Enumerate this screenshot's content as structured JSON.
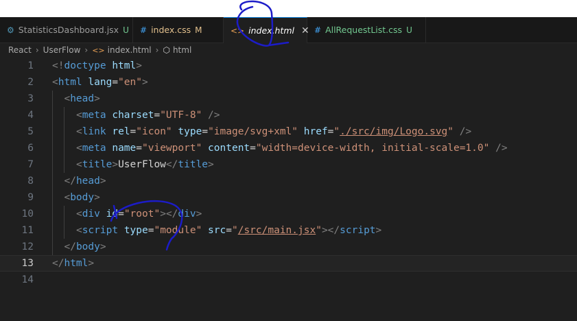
{
  "tabs": [
    {
      "icon": "⚙",
      "label": "StatisticsDashboard.jsx",
      "badge": "U",
      "active": false
    },
    {
      "icon": "#",
      "label": "index.css",
      "badge": "M",
      "active": false
    },
    {
      "icon": "<>",
      "label": "index.html",
      "close": "✕",
      "active": true
    },
    {
      "icon": "#",
      "label": "AllRequestList.css",
      "badge": "U",
      "active": false
    }
  ],
  "breadcrumb": [
    "React",
    "UserFlow",
    "index.html",
    "html"
  ],
  "editor": {
    "current_line": 13,
    "lines": [
      {
        "n": "1",
        "tokens": [
          [
            "p",
            "<!"
          ],
          [
            "tg",
            "doctype"
          ],
          [
            "tx",
            " "
          ],
          [
            "at",
            "html"
          ],
          [
            "p",
            ">"
          ]
        ]
      },
      {
        "n": "2",
        "tokens": [
          [
            "p",
            "<"
          ],
          [
            "tg",
            "html"
          ],
          [
            "tx",
            " "
          ],
          [
            "at",
            "lang"
          ],
          [
            "tx",
            "="
          ],
          [
            "st",
            "\"en\""
          ],
          [
            "p",
            ">"
          ]
        ]
      },
      {
        "n": "3",
        "tokens": [
          [
            "p",
            "<"
          ],
          [
            "tg",
            "head"
          ],
          [
            "p",
            ">"
          ]
        ]
      },
      {
        "n": "4",
        "tokens": [
          [
            "p",
            "<"
          ],
          [
            "tg",
            "meta"
          ],
          [
            "tx",
            " "
          ],
          [
            "at",
            "charset"
          ],
          [
            "tx",
            "="
          ],
          [
            "st",
            "\"UTF-8\""
          ],
          [
            "tx",
            " "
          ],
          [
            "p",
            "/>"
          ]
        ]
      },
      {
        "n": "5",
        "tokens": [
          [
            "p",
            "<"
          ],
          [
            "tg",
            "link"
          ],
          [
            "tx",
            " "
          ],
          [
            "at",
            "rel"
          ],
          [
            "tx",
            "="
          ],
          [
            "st",
            "\"icon\""
          ],
          [
            "tx",
            " "
          ],
          [
            "at",
            "type"
          ],
          [
            "tx",
            "="
          ],
          [
            "st",
            "\"image/svg+xml\""
          ],
          [
            "tx",
            " "
          ],
          [
            "at",
            "href"
          ],
          [
            "tx",
            "="
          ],
          [
            "st",
            "\""
          ],
          [
            "stu",
            "./src/img/Logo.svg"
          ],
          [
            "st",
            "\""
          ],
          [
            "tx",
            " "
          ],
          [
            "p",
            "/>"
          ]
        ]
      },
      {
        "n": "6",
        "tokens": [
          [
            "p",
            "<"
          ],
          [
            "tg",
            "meta"
          ],
          [
            "tx",
            " "
          ],
          [
            "at",
            "name"
          ],
          [
            "tx",
            "="
          ],
          [
            "st",
            "\"viewport\""
          ],
          [
            "tx",
            " "
          ],
          [
            "at",
            "content"
          ],
          [
            "tx",
            "="
          ],
          [
            "st",
            "\"width=device-width, initial-scale=1.0\""
          ],
          [
            "tx",
            " "
          ],
          [
            "p",
            "/>"
          ]
        ]
      },
      {
        "n": "7",
        "tokens": [
          [
            "p",
            "<"
          ],
          [
            "tg",
            "title"
          ],
          [
            "p",
            ">"
          ],
          [
            "tx",
            "UserFlow"
          ],
          [
            "p",
            "</"
          ],
          [
            "tg",
            "title"
          ],
          [
            "p",
            ">"
          ]
        ]
      },
      {
        "n": "8",
        "tokens": [
          [
            "p",
            "</"
          ],
          [
            "tg",
            "head"
          ],
          [
            "p",
            ">"
          ]
        ]
      },
      {
        "n": "9",
        "tokens": [
          [
            "p",
            "<"
          ],
          [
            "tg",
            "body"
          ],
          [
            "p",
            ">"
          ]
        ]
      },
      {
        "n": "10",
        "tokens": [
          [
            "p",
            "<"
          ],
          [
            "tg",
            "div"
          ],
          [
            "tx",
            " "
          ],
          [
            "at",
            "id"
          ],
          [
            "tx",
            "="
          ],
          [
            "st",
            "\"root\""
          ],
          [
            "p",
            "></"
          ],
          [
            "tg",
            "div"
          ],
          [
            "p",
            ">"
          ]
        ]
      },
      {
        "n": "11",
        "tokens": [
          [
            "p",
            "<"
          ],
          [
            "tg",
            "script"
          ],
          [
            "tx",
            " "
          ],
          [
            "at",
            "type"
          ],
          [
            "tx",
            "="
          ],
          [
            "st",
            "\"module\""
          ],
          [
            "tx",
            " "
          ],
          [
            "at",
            "src"
          ],
          [
            "tx",
            "="
          ],
          [
            "st",
            "\""
          ],
          [
            "stu",
            "/src/main.jsx"
          ],
          [
            "st",
            "\""
          ],
          [
            "p",
            "></"
          ],
          [
            "tg",
            "script"
          ],
          [
            "p",
            ">"
          ]
        ]
      },
      {
        "n": "12",
        "tokens": [
          [
            "p",
            "</"
          ],
          [
            "tg",
            "body"
          ],
          [
            "p",
            ">"
          ]
        ]
      },
      {
        "n": "13",
        "tokens": [
          [
            "p",
            "</"
          ],
          [
            "tg",
            "html"
          ],
          [
            "p",
            ">"
          ]
        ]
      },
      {
        "n": "14",
        "tokens": []
      }
    ]
  },
  "colors": {
    "background": "#1f1f1f",
    "tag": "#569cd6",
    "attribute": "#9cdcfe",
    "string": "#ce9178",
    "punctuation": "#808080",
    "annotation_ink": "#1c1cc8"
  }
}
